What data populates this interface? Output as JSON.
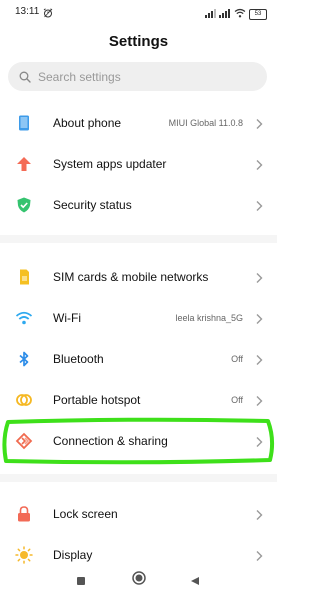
{
  "status_bar": {
    "time": "13:11",
    "battery": "53",
    "icons": [
      "alarm-icon",
      "signal-icon",
      "wifi-icon",
      "battery-icon"
    ]
  },
  "header": {
    "title": "Settings"
  },
  "search": {
    "placeholder": "Search settings",
    "value": ""
  },
  "items": [
    {
      "label": "About phone",
      "value": "MIUI Global 11.0.8",
      "icon": "phone-icon",
      "color": "#3d9be9"
    },
    {
      "label": "System apps updater",
      "value": "",
      "icon": "arrow-up-icon",
      "color": "#f46b56"
    },
    {
      "label": "Security status",
      "value": "",
      "icon": "shield-check-icon",
      "color": "#35c36f"
    },
    {
      "label": "SIM cards & mobile networks",
      "value": "",
      "icon": "sim-card-icon",
      "color": "#f5c022"
    },
    {
      "label": "Wi-Fi",
      "value": "leela krishna_5G",
      "icon": "wifi-icon",
      "color": "#2ea9ef"
    },
    {
      "label": "Bluetooth",
      "value": "Off",
      "icon": "bluetooth-icon",
      "color": "#2e8de8"
    },
    {
      "label": "Portable hotspot",
      "value": "Off",
      "icon": "hotspot-icon",
      "color": "#f5b823"
    },
    {
      "label": "Connection & sharing",
      "value": "",
      "icon": "connection-sharing-icon",
      "color": "#f06a4f"
    },
    {
      "label": "Lock screen",
      "value": "",
      "icon": "lock-icon",
      "color": "#f26a56"
    },
    {
      "label": "Display",
      "value": "",
      "icon": "sun-icon",
      "color": "#f6b92b"
    }
  ],
  "highlight": {
    "color": "#3ee01a",
    "target": "Connection & sharing"
  },
  "nav": {
    "icons": [
      "recents-square-icon",
      "home-circle-icon",
      "back-triangle-icon"
    ]
  }
}
